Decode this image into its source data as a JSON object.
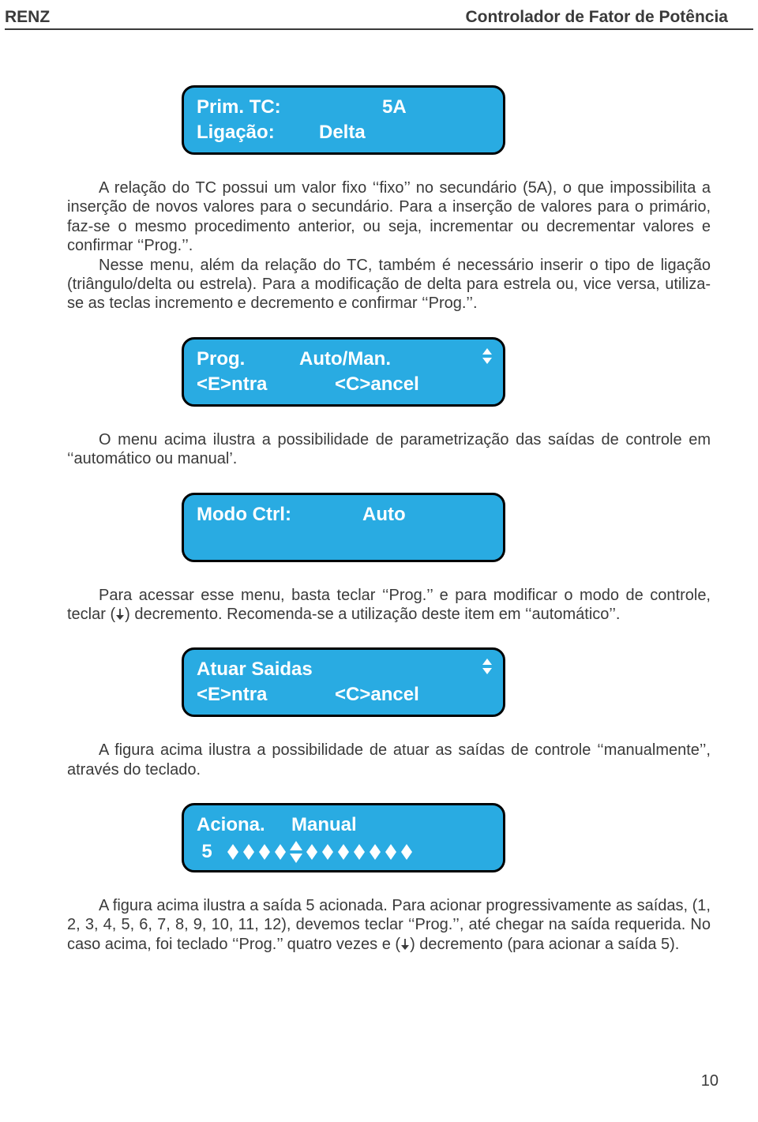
{
  "header": {
    "left": "RENZ",
    "right": "Controlador de Fator de Potência"
  },
  "display1": {
    "r1c1": "Prim. TC:",
    "r1c2": "5A",
    "r2c1": "Ligação:",
    "r2c2": "Delta"
  },
  "para1a": "A relação do TC possui um valor fixo ‘‘fixo’’ no secundário (5A), o que impossibilita a inserção de novos valores para o secundário. Para a inserção de valores para o primário, faz-se o mesmo procedimento anterior, ou seja, incrementar ou decrementar valores e confirmar ‘‘Prog.’’.",
  "para1b": "Nesse menu, além da relação do TC, também é necessário inserir o tipo de ligação (triângulo/delta ou estrela). Para a modificação de delta para estrela ou, vice versa, utiliza-se as teclas incremento e decremento e confirmar ‘‘Prog.’’.",
  "display2": {
    "r1c1": "Prog.",
    "r1c2": "Auto/Man.",
    "r2c1": "<E>ntra",
    "r2c2": "<C>ancel"
  },
  "para2": "O menu acima ilustra a possibilidade de parametrização das saídas de controle em ‘‘automático ou manual’.",
  "display3": {
    "r1c1": "Modo Ctrl:",
    "r1c2": "Auto"
  },
  "para3a": "Para acessar esse menu, basta teclar ‘‘Prog.’’ e para modificar o modo de controle, teclar (",
  "para3b": ") decremento. Recomenda-se a utilização deste item em ‘‘automático’’.",
  "display4": {
    "r1c1": "Atuar Saidas",
    "r2c1": "<E>ntra",
    "r2c2": "<C>ancel"
  },
  "para4": "A figura acima ilustra a possibilidade de atuar as saídas de controle ‘‘manualmente’’, através do teclado.",
  "display5": {
    "r1c1": "Aciona.",
    "r1c2": "Manual",
    "num": "5"
  },
  "para5a": "A figura acima ilustra a saída 5 acionada. Para acionar progressivamente as saídas, (1, 2, 3, 4, 5, 6, 7, 8, 9, 10, 11, 12), devemos teclar ‘‘Prog.’’, até chegar na saída requerida. No caso acima, foi teclado ‘‘Prog.’’  quatro vezes e (",
  "para5b": ") decremento (para acionar a saída 5).",
  "page_number": "10"
}
